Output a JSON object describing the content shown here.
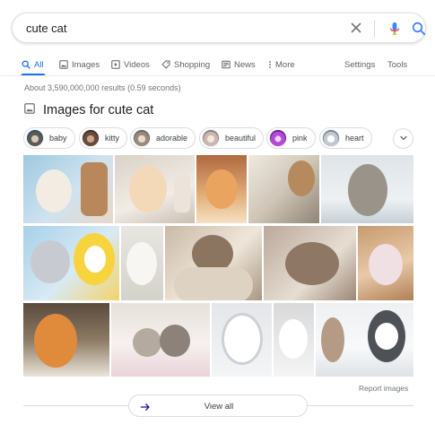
{
  "search": {
    "query": "cute cat"
  },
  "tabs": [
    {
      "label": "All",
      "icon": "search-icon",
      "active": true
    },
    {
      "label": "Images",
      "icon": "image-icon"
    },
    {
      "label": "Videos",
      "icon": "video-icon"
    },
    {
      "label": "Shopping",
      "icon": "tag-icon"
    },
    {
      "label": "News",
      "icon": "newspaper-icon"
    },
    {
      "label": "More",
      "icon": "more-vert-icon"
    }
  ],
  "tools": {
    "settings": "Settings",
    "tools": "Tools"
  },
  "results": {
    "stats": "About 3,590,000,000 results (0.59 seconds)"
  },
  "images_section": {
    "title": "Images for cute cat",
    "chips": [
      {
        "label": "baby"
      },
      {
        "label": "kitty"
      },
      {
        "label": "adorable"
      },
      {
        "label": "beautiful"
      },
      {
        "label": "pink"
      },
      {
        "label": "heart"
      }
    ],
    "report_link": "Report images",
    "view_all": "View all"
  },
  "colors": {
    "accent": "#1a73e8",
    "text_primary": "#202124",
    "text_secondary": "#70757a",
    "border": "#dadce0",
    "mic_blue": "#4285f4",
    "mic_red": "#ea4335"
  }
}
